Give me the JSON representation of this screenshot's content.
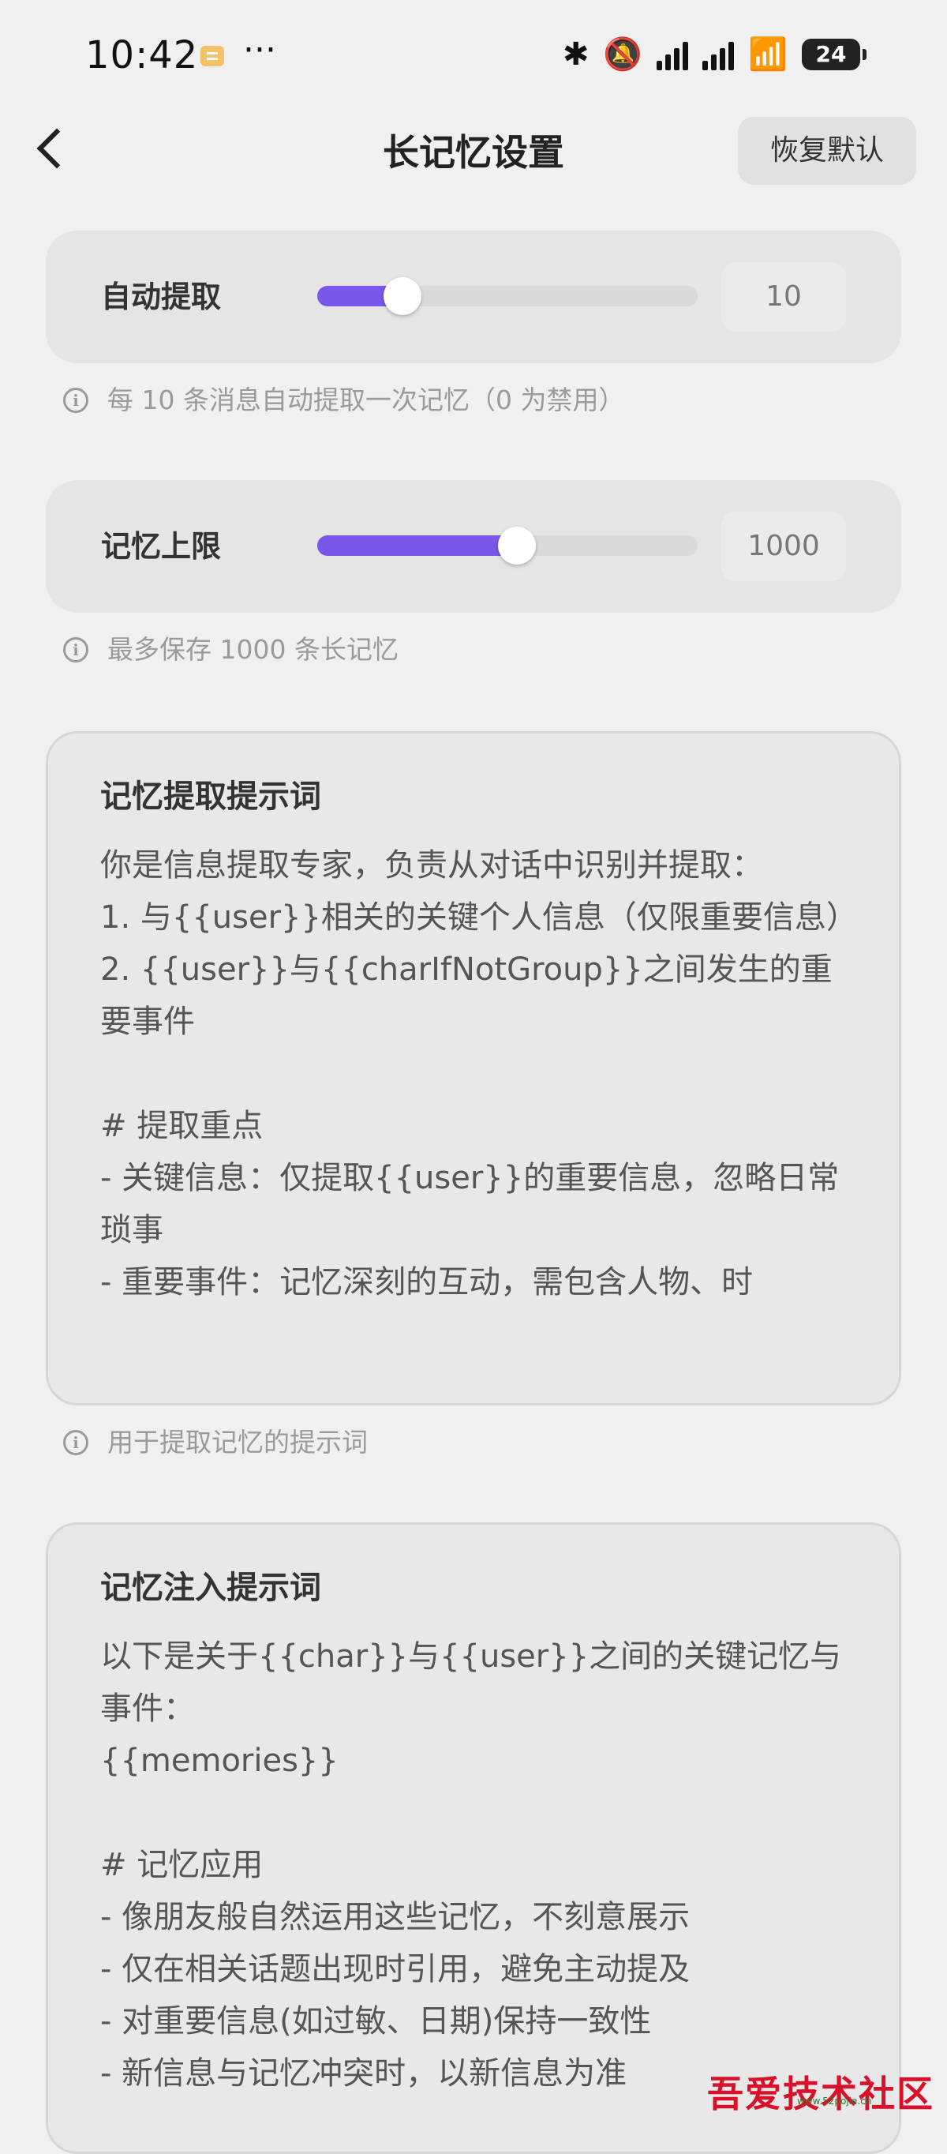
{
  "status_bar": {
    "time": "10:42",
    "dots": "···",
    "bluetooth_glyph": "✱",
    "bell_glyph": "🔕",
    "wifi_glyph": "📶",
    "battery": "24"
  },
  "header": {
    "title": "长记忆设置",
    "reset_label": "恢复默认"
  },
  "auto_extract": {
    "label": "自动提取",
    "value": "10",
    "fraction": 0.2,
    "hint": "每 10 条消息自动提取一次记忆（0 为禁用）"
  },
  "memory_limit": {
    "label": "记忆上限",
    "value": "1000",
    "fraction": 0.5,
    "hint": "最多保存 1000 条长记忆"
  },
  "extract_prompt": {
    "title": "记忆提取提示词",
    "body": "你是信息提取专家，负责从对话中识别并提取：\n1. 与{{user}}相关的关键个人信息（仅限重要信息）\n2. {{user}}与{{charIfNotGroup}}之间发生的重要事件\n\n# 提取重点\n- 关键信息：仅提取{{user}}的重要信息，忽略日常琐事\n- 重要事件：记忆深刻的互动，需包含人物、时",
    "hint": "用于提取记忆的提示词"
  },
  "inject_prompt": {
    "title": "记忆注入提示词",
    "body": "以下是关于{{char}}与{{user}}之间的关键记忆与事件：\n{{memories}}\n\n# 记忆应用\n- 像朋友般自然运用这些记忆，不刻意展示\n- 仅在相关话题出现时引用，避免主动提及\n- 对重要信息(如过敏、日期)保持一致性\n- 新信息与记忆冲突时，以新信息为准"
  },
  "watermark": {
    "text": "吾爱技术社区",
    "sub": "www.52pojie.cn"
  },
  "colors": {
    "accent": "#7a57e8",
    "background": "#f0f0f0",
    "card": "#e5e5e5"
  }
}
